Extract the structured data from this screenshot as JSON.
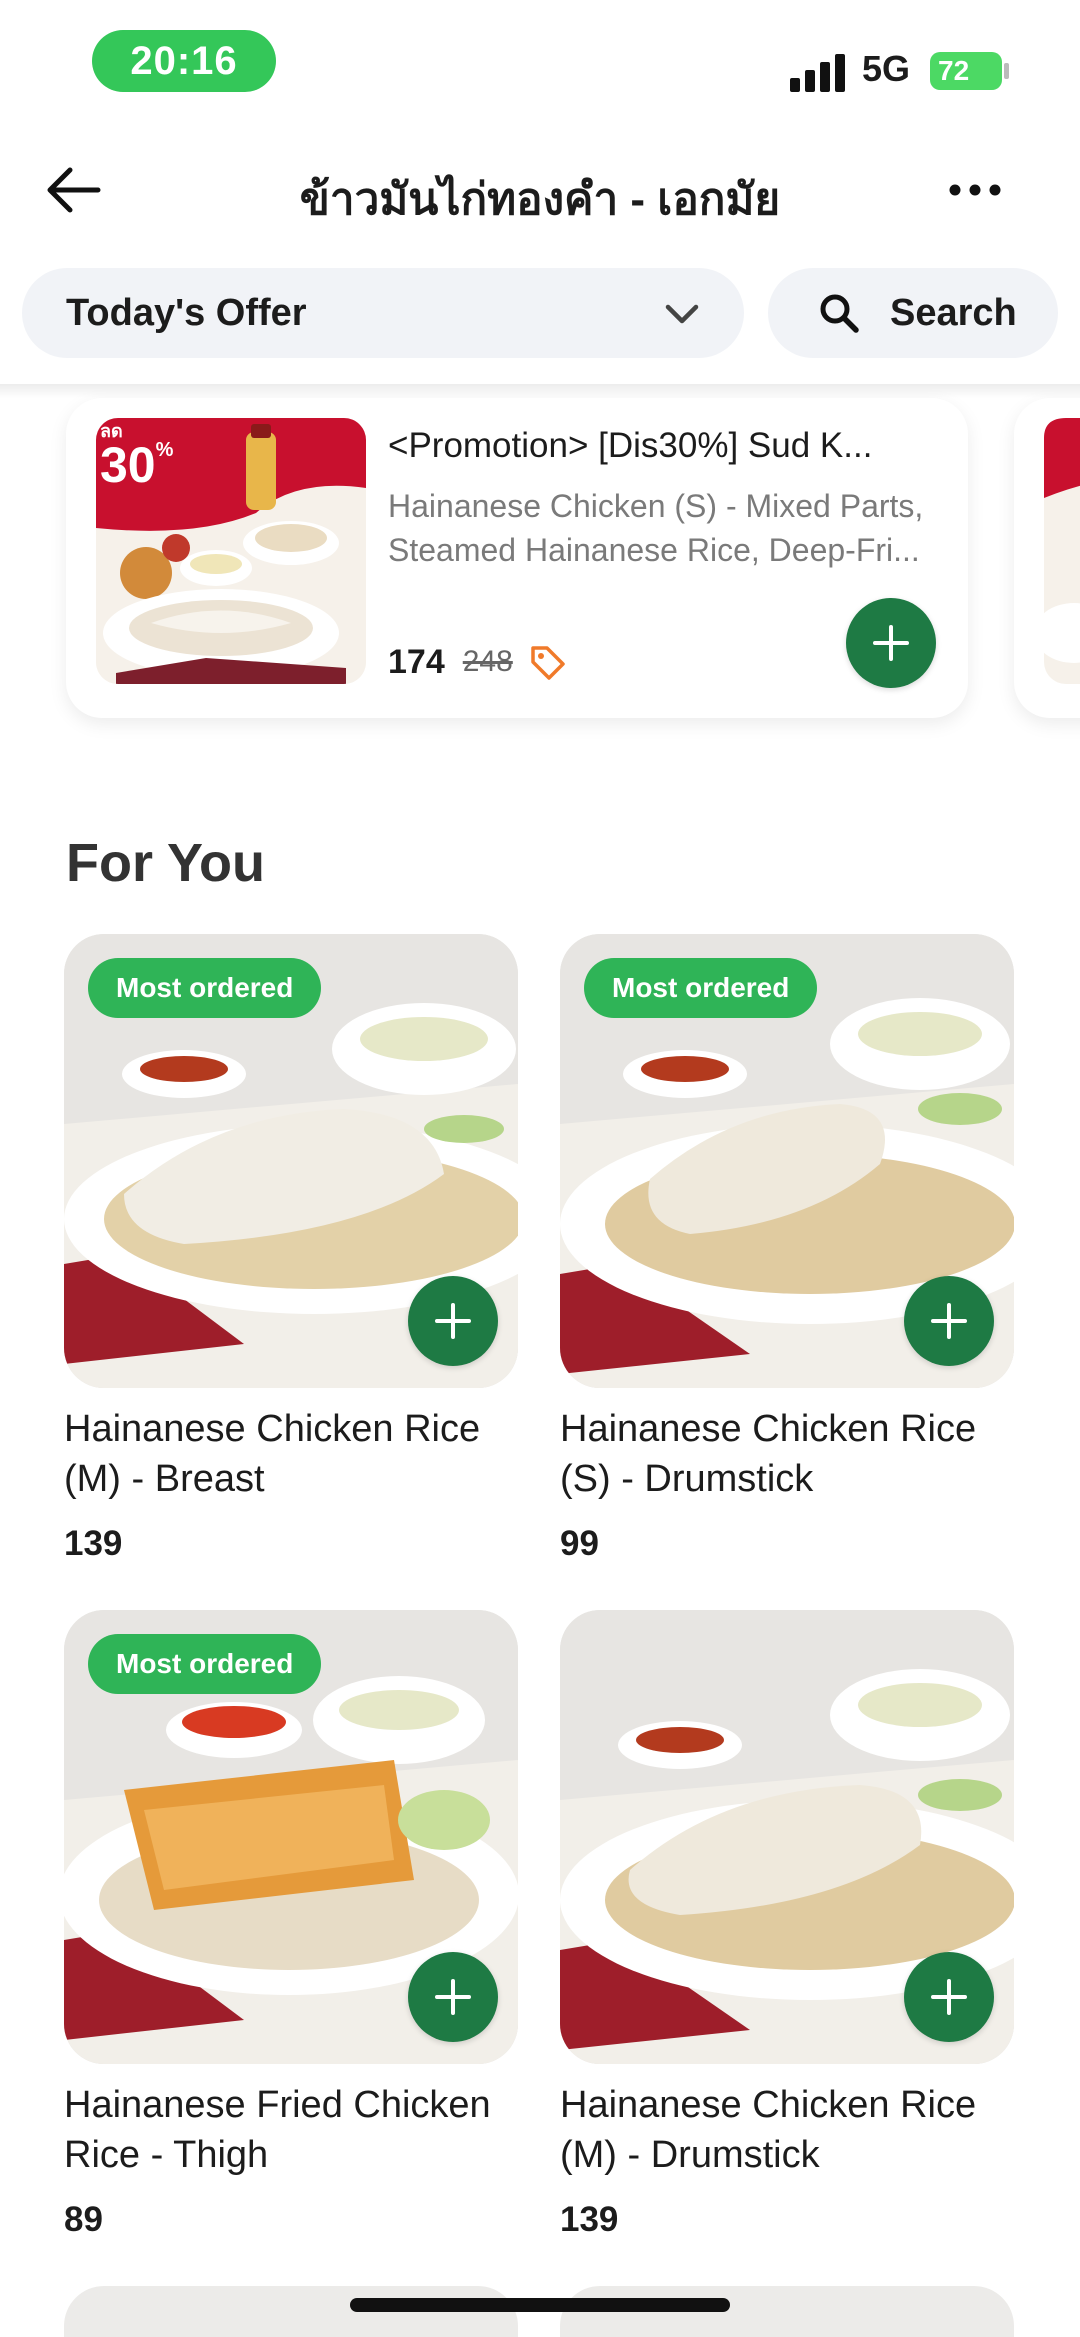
{
  "status_bar": {
    "time": "20:16",
    "network": "5G",
    "battery": "72"
  },
  "header": {
    "title": "ข้าวมันไก่ทองคำ - เอกมัย",
    "back_icon": "arrow-left-icon",
    "more_icon": "more-horizontal-icon"
  },
  "filters": {
    "offer_label": "Today's Offer",
    "search_label": "Search"
  },
  "promo": {
    "badge_small": "ลด",
    "badge_percent": "30",
    "badge_sign": "%",
    "title": "<Promotion> [Dis30%] Sud K...",
    "desc_line1": "Hainanese Chicken (S) - Mixed Parts,",
    "desc_line2": "Steamed Hainanese Rice, Deep-Fri...",
    "price": "174",
    "old_price": "248"
  },
  "section": {
    "title": "For You"
  },
  "items": [
    {
      "badge": "Most ordered",
      "name_line1": "Hainanese Chicken Rice",
      "name_line2": "(M) - Breast",
      "price": "139"
    },
    {
      "badge": "Most ordered",
      "name_line1": "Hainanese Chicken Rice",
      "name_line2": "(S) - Drumstick",
      "price": "99"
    },
    {
      "badge": "Most ordered",
      "name_line1": "Hainanese Fried Chicken",
      "name_line2": "Rice - Thigh",
      "price": "89"
    },
    {
      "badge": "",
      "name_line1": "Hainanese Chicken Rice",
      "name_line2": "(M) - Drumstick",
      "price": "139"
    }
  ],
  "colors": {
    "accent_green": "#1e7a44",
    "badge_green": "#2fb457",
    "status_green": "#34c759"
  }
}
